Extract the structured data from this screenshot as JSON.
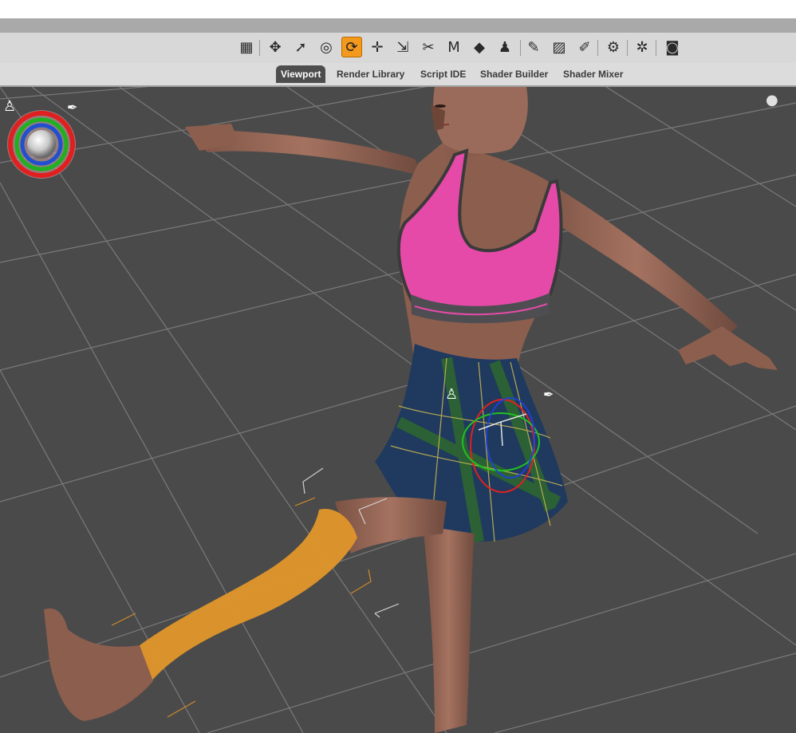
{
  "toolbar": {
    "tools": [
      {
        "name": "grid-tool-icon",
        "glyph": "▦",
        "active": false
      },
      {
        "name": "orbit-tool-icon",
        "glyph": "✥",
        "active": false
      },
      {
        "name": "select-tool-icon",
        "glyph": "➚",
        "active": false
      },
      {
        "name": "node-select-tool-icon",
        "glyph": "◎",
        "active": false
      },
      {
        "name": "rotate-tool-icon",
        "glyph": "⟳",
        "active": true
      },
      {
        "name": "translate-tool-icon",
        "glyph": "✛",
        "active": false
      },
      {
        "name": "scale-tool-icon",
        "glyph": "⇲",
        "active": false
      },
      {
        "name": "joint-editor-icon",
        "glyph": "✂",
        "active": false
      },
      {
        "name": "geometry-editor-icon",
        "glyph": "M",
        "active": false
      },
      {
        "name": "surface-selection-icon",
        "glyph": "◆",
        "active": false
      },
      {
        "name": "figure-tool-icon",
        "glyph": "♟",
        "active": false
      },
      {
        "name": "node-weight-brush-icon",
        "glyph": "✎",
        "active": false
      },
      {
        "name": "geometry-brush-icon",
        "glyph": "▨",
        "active": false
      },
      {
        "name": "edit-tool-icon",
        "glyph": "✐",
        "active": false
      },
      {
        "name": "camera-settings-icon",
        "glyph": "⚙",
        "active": false
      },
      {
        "name": "scene-settings-icon",
        "glyph": "✲",
        "active": false
      },
      {
        "name": "render-camera-icon",
        "glyph": "◙",
        "active": false
      }
    ]
  },
  "tabs": [
    {
      "label": "Viewport",
      "active": true
    },
    {
      "label": "Render Library",
      "active": false
    },
    {
      "label": "Script IDE",
      "active": false
    },
    {
      "label": "Shader Builder",
      "active": false
    },
    {
      "label": "Shader Mixer",
      "active": false
    }
  ],
  "colors": {
    "viewport_bg": "#4a4a4a",
    "active_tool": "#f39a1e",
    "selection_highlight": "#e0962a",
    "top_color": "#e64aa8",
    "skirt_color": "#1f3a5e"
  }
}
